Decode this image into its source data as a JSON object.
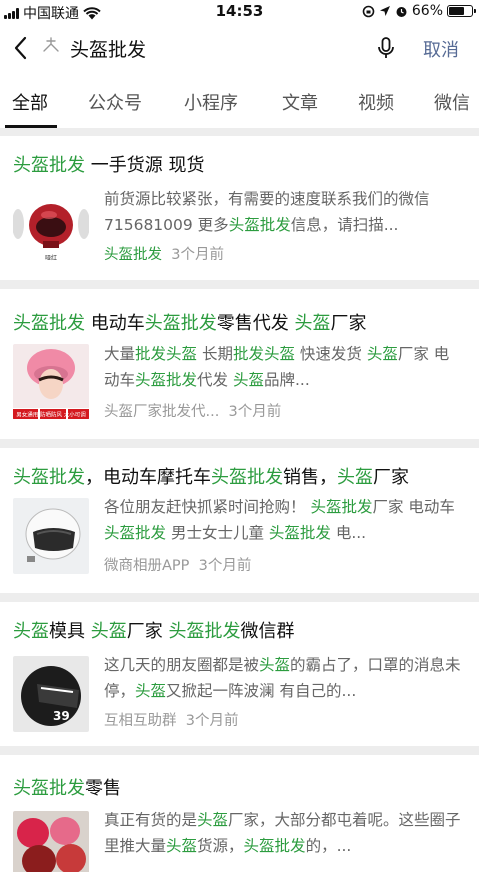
{
  "status_bar": {
    "carrier": "中国联通",
    "time": "14:53",
    "battery": "66%",
    "battery_level": 0.66
  },
  "search": {
    "query": "头盔批发",
    "cancel_label": "取消"
  },
  "tabs": [
    "全部",
    "公众号",
    "小程序",
    "文章",
    "视频",
    "微信"
  ],
  "results": [
    {
      "title": [
        {
          "t": "头盔批发",
          "h": true
        },
        {
          "t": " 一手货源 现货",
          "h": false
        }
      ],
      "snippet": [
        {
          "t": "前货源比较紧张，有需要的速度联系我们的微信 715681009 更多",
          "h": false
        },
        {
          "t": "头盔批发",
          "h": true
        },
        {
          "t": "信息，请扫描...",
          "h": false
        }
      ],
      "source": "头盔批发",
      "source_highlight": true,
      "time": "3个月前",
      "thumb_caption": "哑红",
      "thumb_style": "red-helmet"
    },
    {
      "title": [
        {
          "t": "头盔批发",
          "h": true
        },
        {
          "t": " 电动车",
          "h": false
        },
        {
          "t": "头盔批发",
          "h": true
        },
        {
          "t": "零售代发 ",
          "h": false
        },
        {
          "t": "头盔",
          "h": true
        },
        {
          "t": "厂家",
          "h": false
        }
      ],
      "snippet": [
        {
          "t": "大量",
          "h": false
        },
        {
          "t": "批发头盔",
          "h": true
        },
        {
          "t": " 长期",
          "h": false
        },
        {
          "t": "批发头盔",
          "h": true
        },
        {
          "t": " 快速发货 ",
          "h": false
        },
        {
          "t": "头盔",
          "h": true
        },
        {
          "t": "厂家 电动车",
          "h": false
        },
        {
          "t": "头盔批发",
          "h": true
        },
        {
          "t": "代发 ",
          "h": false
        },
        {
          "t": "头盔",
          "h": true
        },
        {
          "t": "品牌...",
          "h": false
        }
      ],
      "source": "头盔厂家批发代...",
      "source_highlight": false,
      "time": "3个月前",
      "thumb_caption": "男女通用 防晒防风 大小可调",
      "thumb_style": "pink-helmet"
    },
    {
      "title": [
        {
          "t": "头盔批发",
          "h": true
        },
        {
          "t": "，电动车摩托车",
          "h": false
        },
        {
          "t": "头盔批发",
          "h": true
        },
        {
          "t": "销售，",
          "h": false
        },
        {
          "t": "头盔",
          "h": true
        },
        {
          "t": "厂家",
          "h": false
        }
      ],
      "snippet": [
        {
          "t": "各位朋友赶快抓紧时间抢购！ ",
          "h": false
        },
        {
          "t": "头盔批发",
          "h": true
        },
        {
          "t": "厂家 电动车",
          "h": false
        },
        {
          "t": "头盔批发",
          "h": true
        },
        {
          "t": " 男士女士儿童 ",
          "h": false
        },
        {
          "t": "头盔批发",
          "h": true
        },
        {
          "t": " 电...",
          "h": false
        }
      ],
      "source": "微商相册APP",
      "source_highlight": false,
      "time": "3个月前",
      "thumb_caption": "",
      "thumb_style": "white-helmet"
    },
    {
      "title": [
        {
          "t": "头盔",
          "h": true
        },
        {
          "t": "模具 ",
          "h": false
        },
        {
          "t": "头盔",
          "h": true
        },
        {
          "t": "厂家 ",
          "h": false
        },
        {
          "t": "头盔批发",
          "h": true
        },
        {
          "t": "微信群",
          "h": false
        }
      ],
      "snippet": [
        {
          "t": "这几天的朋友圈都是被",
          "h": false
        },
        {
          "t": "头盔",
          "h": true
        },
        {
          "t": "的霸占了，口罩的消息未停，",
          "h": false
        },
        {
          "t": "头盔",
          "h": true
        },
        {
          "t": "又掀起一阵波澜 有自己的...",
          "h": false
        }
      ],
      "source": "互相互助群",
      "source_highlight": false,
      "time": "3个月前",
      "thumb_caption": "",
      "thumb_style": "black-helmet"
    },
    {
      "title": [
        {
          "t": "头盔批发",
          "h": true
        },
        {
          "t": "零售",
          "h": false
        }
      ],
      "snippet": [
        {
          "t": "真正有货的是",
          "h": false
        },
        {
          "t": "头盔",
          "h": true
        },
        {
          "t": "厂家，大部分都屯着呢。这些圈子里推大量",
          "h": false
        },
        {
          "t": "头盔",
          "h": true
        },
        {
          "t": "货源，",
          "h": false
        },
        {
          "t": "头盔批发",
          "h": true
        },
        {
          "t": "的，...",
          "h": false
        }
      ],
      "source": "",
      "source_highlight": false,
      "time": "",
      "thumb_caption": "",
      "thumb_style": "multi-helmet"
    }
  ],
  "colors": {
    "highlight": "#2c9c3f",
    "link": "#576b95",
    "snippet": "#666666",
    "source": "#999999",
    "divider": "#ededed"
  }
}
